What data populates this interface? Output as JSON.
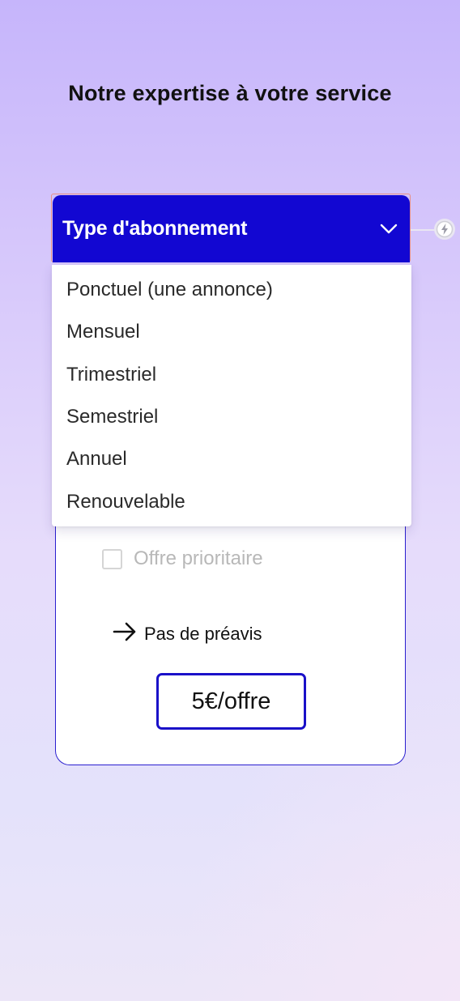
{
  "header": {
    "title": "Notre expertise à votre service"
  },
  "subscription_select": {
    "label": "Type d'abonnement",
    "expanded": true,
    "options": [
      "Ponctuel (une annonce)",
      "Mensuel",
      "Trimestriel",
      "Semestriel",
      "Annuel",
      "Renouvelable"
    ]
  },
  "card": {
    "priority_label": "Offre prioritaire",
    "priority_checked": false,
    "notice_text": "Pas de préavis",
    "price_label": "5€/offre"
  },
  "colors": {
    "brand": "#1207d2",
    "background_top": "#c6b5fb",
    "background_bottom": "#ece6f8"
  },
  "icons": {
    "dropdown": "chevron-down-icon",
    "badge": "bolt-icon",
    "notice": "arrow-right-icon",
    "checkbox": "checkbox-icon"
  }
}
